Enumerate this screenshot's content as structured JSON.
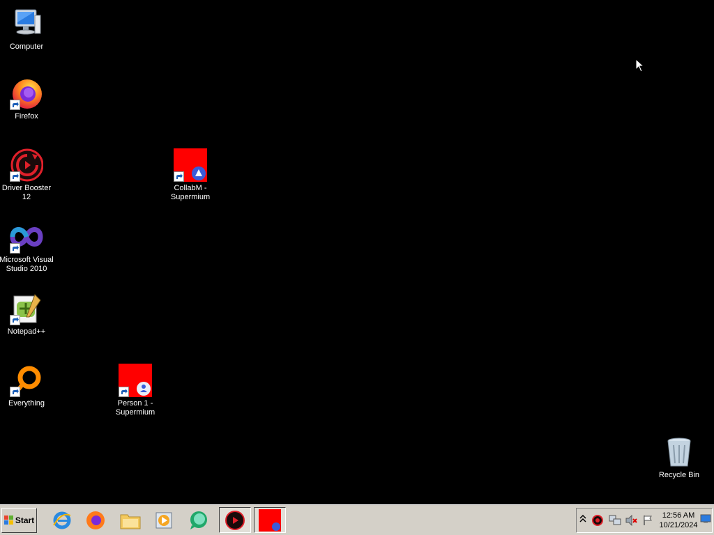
{
  "desktop": {
    "icons": {
      "computer": "Computer",
      "firefox": "Firefox",
      "driver_booster_line1": "Driver Booster",
      "driver_booster_line2": "12",
      "collabm_line1": "CollabM -",
      "collabm_line2": "Supermium",
      "visual_studio_line1": "Microsoft Visual",
      "visual_studio_line2": "Studio 2010",
      "notepad": "Notepad++",
      "everything": "Everything",
      "person1_line1": "Person 1 -",
      "person1_line2": "Supermium",
      "recycle_bin": "Recycle Bin"
    }
  },
  "taskbar": {
    "start_label": "Start",
    "pinned": [
      "internet-explorer",
      "firefox",
      "file-explorer",
      "media-player",
      "chat-app",
      "driver-booster",
      "supermium-window"
    ],
    "clock": {
      "time": "12:56 AM",
      "date": "10/21/2024"
    }
  },
  "colors": {
    "desktop_background": "#000000",
    "taskbar": "#d4d0c8",
    "supermium_red": "#ff0000"
  }
}
